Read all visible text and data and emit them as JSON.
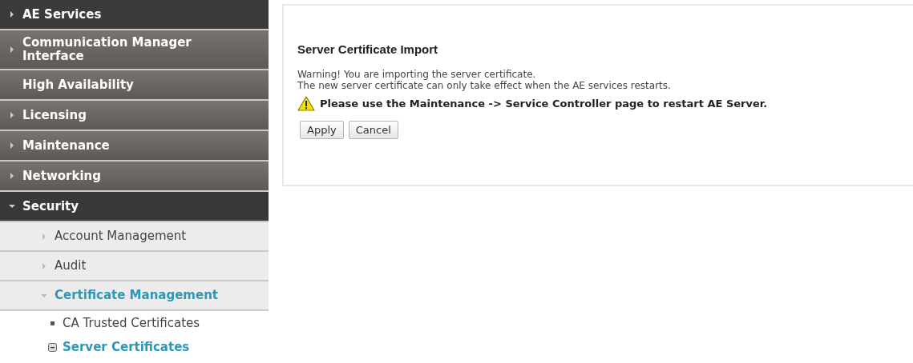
{
  "sidebar": {
    "items": [
      {
        "label": "AE Services",
        "kind": "arrow",
        "expanded": false,
        "selected": false
      },
      {
        "label": "Communication Manager Interface",
        "kind": "arrow",
        "expanded": false,
        "selected": false
      },
      {
        "label": "High Availability",
        "kind": "none",
        "selected": false
      },
      {
        "label": "Licensing",
        "kind": "arrow",
        "expanded": false,
        "selected": false
      },
      {
        "label": "Maintenance",
        "kind": "arrow",
        "expanded": false,
        "selected": false
      },
      {
        "label": "Networking",
        "kind": "arrow",
        "expanded": false,
        "selected": false
      },
      {
        "label": "Security",
        "kind": "arrow",
        "expanded": true,
        "selected": false,
        "children": [
          {
            "label": "Account Management",
            "kind": "arrow",
            "expanded": false,
            "selected": false
          },
          {
            "label": "Audit",
            "kind": "arrow",
            "expanded": false,
            "selected": false
          },
          {
            "label": "Certificate Management",
            "kind": "arrow",
            "expanded": true,
            "selected": true,
            "children": [
              {
                "label": "CA Trusted Certificates",
                "kind": "bullet",
                "selected": false
              },
              {
                "label": "Server Certificates",
                "kind": "box",
                "selected": true
              }
            ]
          }
        ]
      }
    ]
  },
  "panel": {
    "title": "Server Certificate Import",
    "message_lines": [
      "Warning! You are importing the server certificate.",
      "The new server certificate can only take effect when the AE services restarts."
    ],
    "warning": "Please use the Maintenance -> Service Controller page to restart AE Server.",
    "buttons": [
      "Apply",
      "Cancel"
    ]
  }
}
